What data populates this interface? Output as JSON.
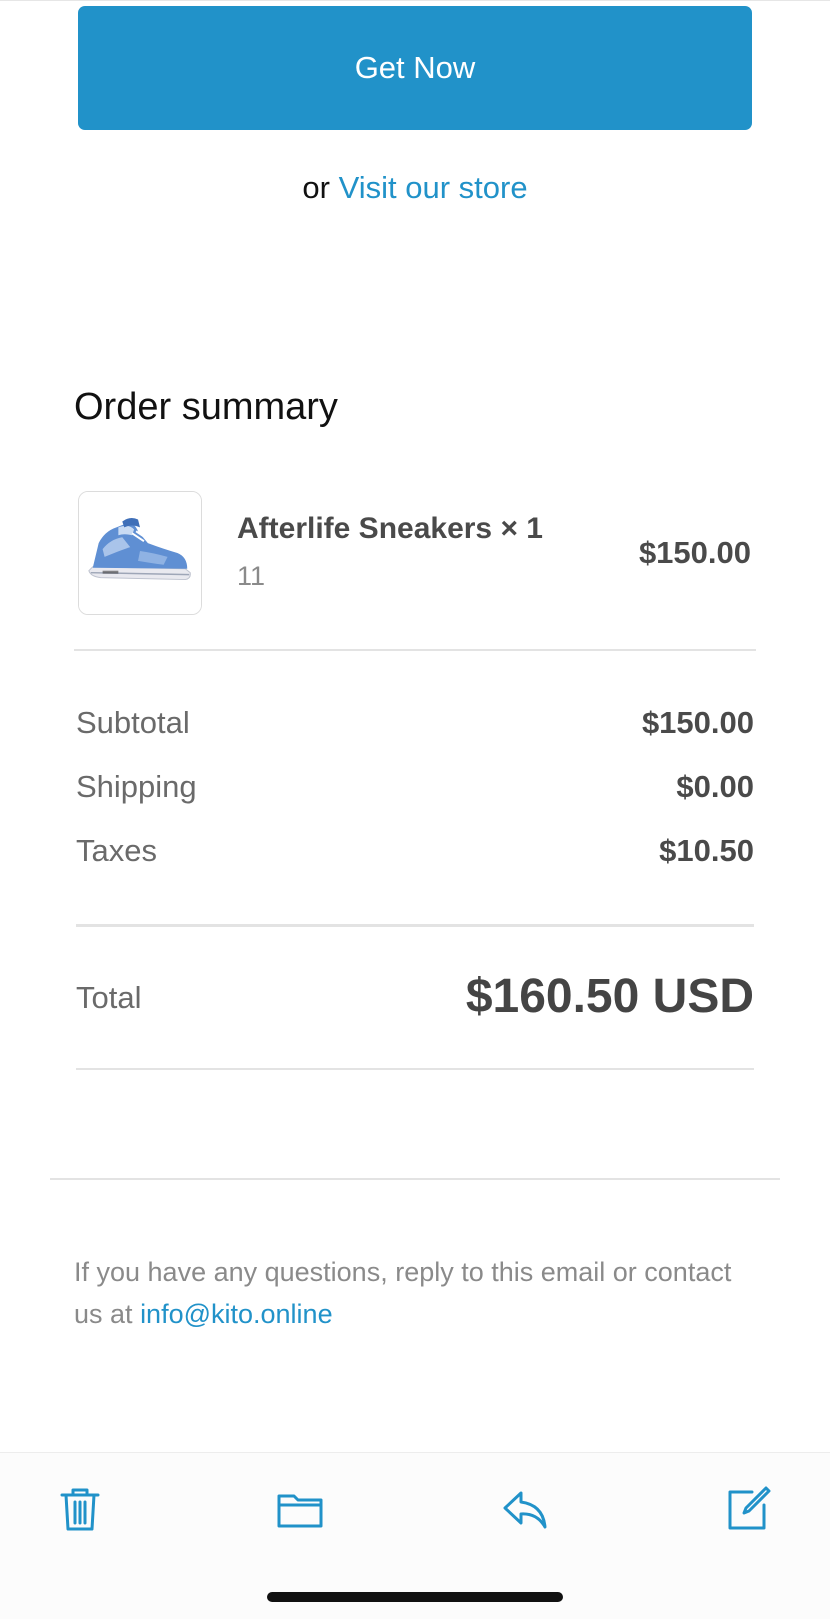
{
  "cta": {
    "label": "Get Now"
  },
  "visit": {
    "prefix": "or",
    "link_text": "Visit our store"
  },
  "order_summary": {
    "title": "Order summary",
    "item": {
      "name": "Afterlife Sneakers × 1",
      "variant": "11",
      "price": "$150.00",
      "image_icon": "sneaker-image"
    },
    "rows": [
      {
        "label": "Subtotal",
        "value": "$150.00"
      },
      {
        "label": "Shipping",
        "value": "$0.00"
      },
      {
        "label": "Taxes",
        "value": "$10.50"
      }
    ],
    "total": {
      "label": "Total",
      "value": "$160.50 USD"
    }
  },
  "footer": {
    "text": "If you have any questions, reply to this email or contact us at",
    "email": "info@kito.online"
  },
  "toolbar": {
    "items": [
      {
        "icon": "trash-icon"
      },
      {
        "icon": "folder-icon"
      },
      {
        "icon": "reply-icon"
      },
      {
        "icon": "compose-icon"
      }
    ]
  },
  "colors": {
    "accent": "#2192c9",
    "text_dark": "#111111",
    "text_muted": "#8a8a8a",
    "value_text": "#4a4a4a"
  }
}
